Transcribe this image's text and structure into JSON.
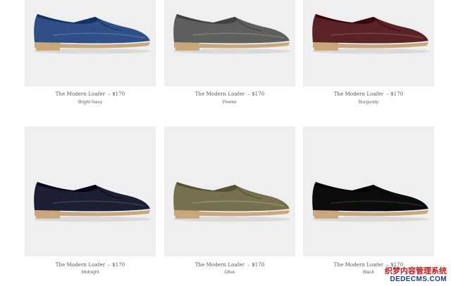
{
  "products": [
    {
      "name": "The Modern Loafer",
      "price": "– $170",
      "color": "Bright Navy",
      "swatch": "#2f4f86"
    },
    {
      "name": "The Modern Loafer",
      "price": "– $170",
      "color": "Pewter",
      "swatch": "#5d605d"
    },
    {
      "name": "The Modern Loafer",
      "price": "– $170",
      "color": "Burgundy",
      "swatch": "#5a2426"
    },
    {
      "name": "The Modern Loafer",
      "price": "– $170",
      "color": "Midnight",
      "swatch": "#1d1f33"
    },
    {
      "name": "The Modern Loafer",
      "price": "– $170",
      "color": "Olive",
      "swatch": "#77704f"
    },
    {
      "name": "The Modern Loafer",
      "price": "– $170",
      "color": "Black",
      "swatch": "#0c0c0c"
    }
  ],
  "watermark": {
    "line1": "织梦内容管理系统",
    "line2": "DEDECMS.COM"
  }
}
